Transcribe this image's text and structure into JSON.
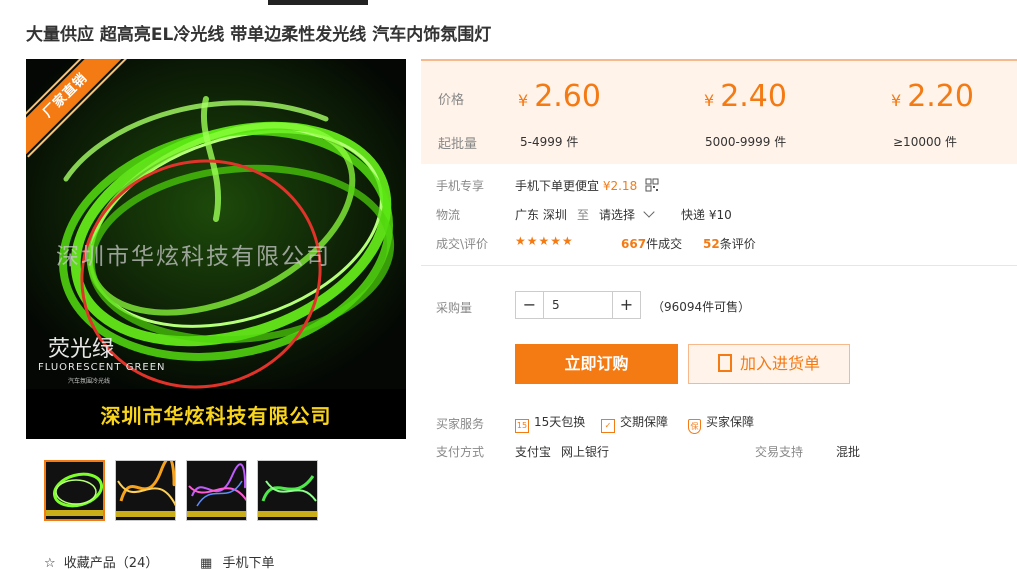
{
  "product": {
    "title": "大量供应 超高亮EL冷光线 带单边柔性发光线 汽车内饰氛围灯"
  },
  "main_image": {
    "ribbon": "厂家直销",
    "watermark": "深圳市华炫科技有限公司",
    "color_name": "荧光绿",
    "color_name_en": "FLUORESCENT GREEN",
    "color_name_sub": "汽车氛围冷光线",
    "banner": "深圳市华炫科技有限公司"
  },
  "price_table": {
    "price_label": "价格",
    "qty_label": "起批量",
    "currency": "¥",
    "tiers": [
      {
        "price": "2.60",
        "qty": "5-4999 件"
      },
      {
        "price": "2.40",
        "qty": "5000-9999 件"
      },
      {
        "price": "2.20",
        "qty": "≥10000 件"
      }
    ]
  },
  "mobile": {
    "label": "手机专享",
    "text": "手机下单更便宜",
    "price": "¥2.18"
  },
  "logistics": {
    "label": "物流",
    "origin": "广东 深圳",
    "to": "至",
    "select": "请选择",
    "express": "快递 ¥10"
  },
  "reviews": {
    "label": "成交\\评价",
    "stars": "★★★★★",
    "deals_count": "667",
    "deals_text": "件成交",
    "review_count": "52",
    "review_text": "条评价"
  },
  "purchase": {
    "label": "采购量",
    "minus": "−",
    "plus": "+",
    "quantity": "5",
    "stock": "（96094件可售）"
  },
  "buttons": {
    "buy": "立即订购",
    "cart": "加入进货单"
  },
  "services": {
    "label": "买家服务",
    "items": [
      "15天包换",
      "交期保障",
      "买家保障"
    ],
    "icon15": "15"
  },
  "payment": {
    "label": "支付方式",
    "methods": [
      "支付宝",
      "网上银行"
    ],
    "trade_label": "交易支持",
    "trade_value": "混批"
  },
  "footer": {
    "favorite": "收藏产品（24）",
    "mobile_order": "手机下单"
  },
  "colors": {
    "accent": "#f47a14",
    "price_bg": "#fff3ea",
    "neon_green": "#7cff2a"
  }
}
